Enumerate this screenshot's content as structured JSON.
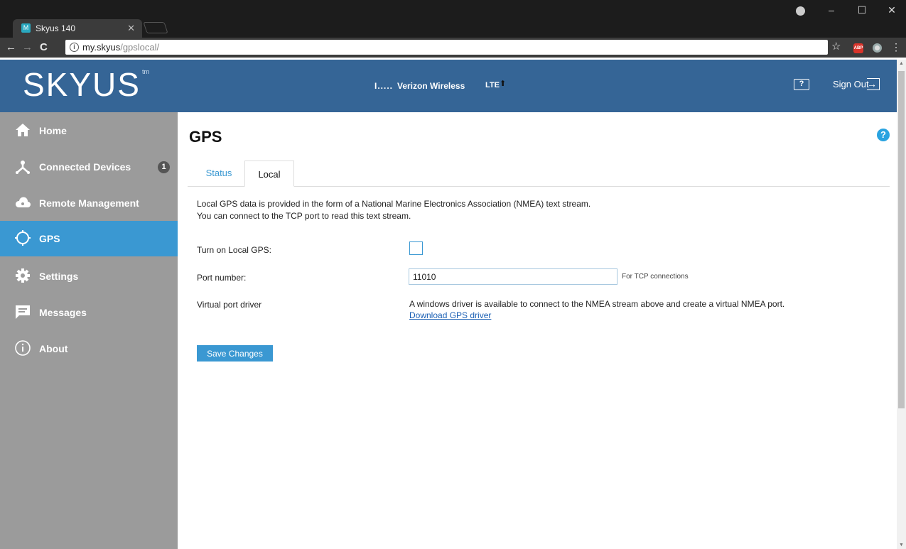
{
  "browser": {
    "tab_title": "Skyus 140",
    "tab_favicon": "M",
    "url_host": "my.skyus",
    "url_path": "/gpslocal/"
  },
  "header": {
    "logo": "SKYUS",
    "logo_tm": "tm",
    "signal": "I.....",
    "carrier": "Verizon Wireless",
    "technology": "LTE",
    "help_label": "?",
    "signout_label": "Sign Out"
  },
  "sidebar": {
    "items": [
      {
        "label": "Home",
        "icon": "home-icon"
      },
      {
        "label": "Connected Devices",
        "icon": "devices-icon",
        "badge": "1"
      },
      {
        "label": "Remote Management",
        "icon": "cloud-icon"
      },
      {
        "label": "GPS",
        "icon": "crosshair-icon",
        "active": true
      },
      {
        "label": "Settings",
        "icon": "gear-icon"
      },
      {
        "label": "Messages",
        "icon": "message-icon"
      },
      {
        "label": "About",
        "icon": "info-icon"
      }
    ]
  },
  "main": {
    "title": "GPS",
    "tabs": [
      "Status",
      "Local"
    ],
    "active_tab": "Local",
    "description_line1": "Local GPS data is provided in the form of a National Marine Electronics Association (NMEA) text stream.",
    "description_line2": "You can connect to the TCP port to read this text stream.",
    "form": {
      "local_gps_label": "Turn on Local GPS:",
      "local_gps_checked": false,
      "port_label": "Port number:",
      "port_value": "11010",
      "port_hint": "For TCP connections",
      "driver_label": "Virtual port driver",
      "driver_text": "A windows driver is available to connect to the NMEA stream above and create a virtual NMEA port.",
      "driver_link": "Download GPS driver"
    },
    "save_label": "Save Changes"
  },
  "colors": {
    "header_bg": "#356596",
    "sidebar_bg": "#9b9b9b",
    "accent": "#3a98d2"
  }
}
